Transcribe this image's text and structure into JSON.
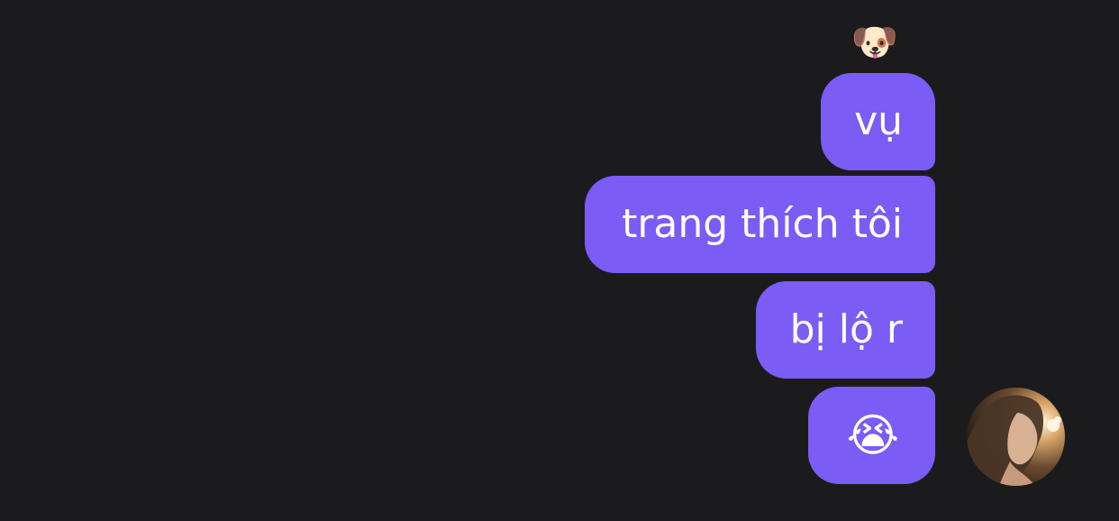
{
  "reaction": {
    "emoji": "🐶"
  },
  "messages": [
    {
      "text": "vụ"
    },
    {
      "text": "trang thích tôi"
    },
    {
      "text": "bị lộ r"
    },
    {
      "text": "😭"
    }
  ],
  "colors": {
    "background": "#1b1b1d",
    "bubble": "#7b5cf5",
    "bubble_text": "#ffffff"
  },
  "avatar": {
    "icon": "user-avatar-photo"
  }
}
